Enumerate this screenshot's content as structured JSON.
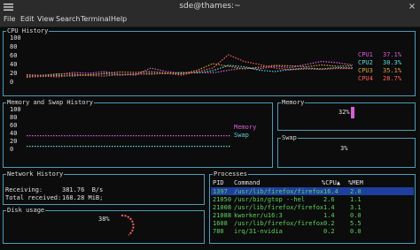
{
  "window": {
    "title": "sde@thames:~",
    "close_glyph": "×"
  },
  "menu": [
    "File",
    "Edit",
    "View",
    "Search",
    "Terminal",
    "Help"
  ],
  "colors": {
    "border": "#4f9ab8",
    "green": "#5fd35f",
    "cpu1": "#d75fd7",
    "cpu2": "#5fd7d7",
    "cpu3": "#d7a040",
    "cpu4": "#ff5f5f",
    "selection": "#1f3f9f"
  },
  "cpu": {
    "title": "CPU History",
    "yticks": [
      "100",
      "80",
      "60",
      "40",
      "20",
      "0"
    ],
    "legend": [
      {
        "label": "CPU1",
        "value": "37.1%"
      },
      {
        "label": "CPU2",
        "value": "30.3%"
      },
      {
        "label": "CPU3",
        "value": "35.1%"
      },
      {
        "label": "CPU4",
        "value": "28.7%"
      }
    ],
    "series": [
      [
        12,
        14,
        15,
        20,
        18,
        22,
        16,
        14,
        30,
        22,
        18,
        20,
        19,
        25,
        30,
        28,
        34,
        31,
        38,
        45,
        42,
        37
      ],
      [
        10,
        11,
        13,
        12,
        15,
        17,
        14,
        16,
        18,
        17,
        20,
        19,
        24,
        36,
        33,
        25,
        22,
        27,
        30,
        28,
        31,
        30
      ],
      [
        15,
        13,
        17,
        16,
        14,
        18,
        21,
        20,
        22,
        19,
        17,
        25,
        40,
        34,
        28,
        32,
        36,
        35,
        33,
        37,
        34,
        35
      ],
      [
        9,
        12,
        10,
        14,
        13,
        12,
        15,
        17,
        16,
        18,
        14,
        22,
        30,
        60,
        45,
        38,
        30,
        26,
        28,
        27,
        29,
        29
      ]
    ]
  },
  "memswap": {
    "title": "Memory and Swap History",
    "yticks": [
      "100",
      "80",
      "60",
      "40",
      "20",
      "0"
    ],
    "legend": [
      "Memory",
      "Swap"
    ],
    "memory_pct": 32,
    "swap_pct": 3
  },
  "memory": {
    "title": "Memory",
    "percent": "32%",
    "level": 0.32
  },
  "swap": {
    "title": "Swap",
    "percent": "3%",
    "level": 0.03
  },
  "network": {
    "title": "Network History",
    "receiving_label": "Receiving:",
    "receiving_value": "381.76  B/s",
    "total_label": "Total received:",
    "total_value": "168.28 MiB;"
  },
  "disk": {
    "title": "Disk usage",
    "percent": "38%"
  },
  "processes": {
    "title": "Processes",
    "headers": [
      "PID",
      "Command",
      "%CPU▲",
      "%MEM"
    ],
    "rows": [
      [
        "1397",
        "/usr/lib/firefox/firefox",
        "16.4",
        "2.0"
      ],
      [
        "21050",
        "/usr/bin/gtop --hel",
        "2.6",
        "1.1"
      ],
      [
        "21008",
        "/usr/lib/firefox/firefox",
        "1.4",
        "3.1"
      ],
      [
        "21088",
        "kworker/u16:3",
        "1.4",
        "0.0"
      ],
      [
        "1608",
        "/usr/lib/firefox/firefox",
        "0.2",
        "5.5"
      ],
      [
        "780",
        "irq/31-nvidia",
        "0.2",
        "0.0"
      ]
    ]
  }
}
